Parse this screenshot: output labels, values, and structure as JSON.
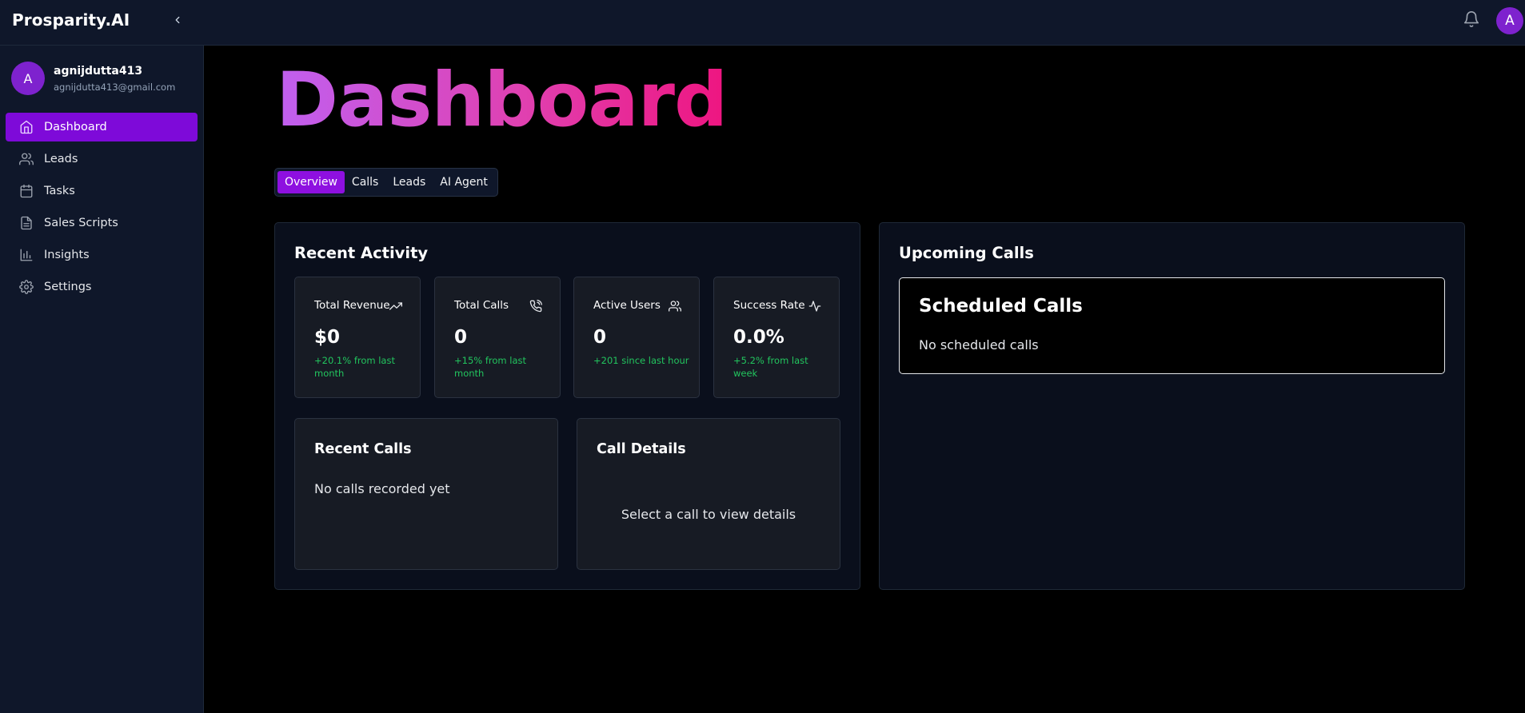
{
  "app": {
    "brand": "Prosparity.AI",
    "avatar_letter": "A"
  },
  "user": {
    "avatar_letter": "A",
    "name": "agnijdutta413",
    "email": "agnijdutta413@gmail.com"
  },
  "nav": [
    {
      "label": "Dashboard",
      "icon": "home-icon",
      "active": true
    },
    {
      "label": "Leads",
      "icon": "users-icon",
      "active": false
    },
    {
      "label": "Tasks",
      "icon": "calendar-icon",
      "active": false
    },
    {
      "label": "Sales Scripts",
      "icon": "document-icon",
      "active": false
    },
    {
      "label": "Insights",
      "icon": "bar-chart-icon",
      "active": false
    },
    {
      "label": "Settings",
      "icon": "gear-icon",
      "active": false
    }
  ],
  "page": {
    "title": "Dashboard"
  },
  "tabs": [
    {
      "label": "Overview",
      "active": true
    },
    {
      "label": "Calls",
      "active": false
    },
    {
      "label": "Leads",
      "active": false
    },
    {
      "label": "AI Agent",
      "active": false
    }
  ],
  "recent_activity": {
    "title": "Recent Activity",
    "stats": [
      {
        "label": "Total Revenue",
        "icon": "trending-up-icon",
        "value": "$0",
        "delta": "+20.1% from last month"
      },
      {
        "label": "Total Calls",
        "icon": "phone-call-icon",
        "value": "0",
        "delta": "+15% from last month"
      },
      {
        "label": "Active Users",
        "icon": "users-icon",
        "value": "0",
        "delta": "+201 since last hour"
      },
      {
        "label": "Success Rate",
        "icon": "activity-icon",
        "value": "0.0%",
        "delta": "+5.2% from last week"
      }
    ],
    "recent_calls": {
      "title": "Recent Calls",
      "empty": "No calls recorded yet"
    },
    "call_details": {
      "title": "Call Details",
      "empty": "Select a call to view details"
    }
  },
  "upcoming_calls": {
    "title": "Upcoming Calls",
    "scheduled": {
      "title": "Scheduled Calls",
      "empty": "No scheduled calls"
    }
  },
  "colors": {
    "accent": "#7e0ad9",
    "positive": "#22c55e",
    "sidebar_bg": "#0f172a"
  }
}
